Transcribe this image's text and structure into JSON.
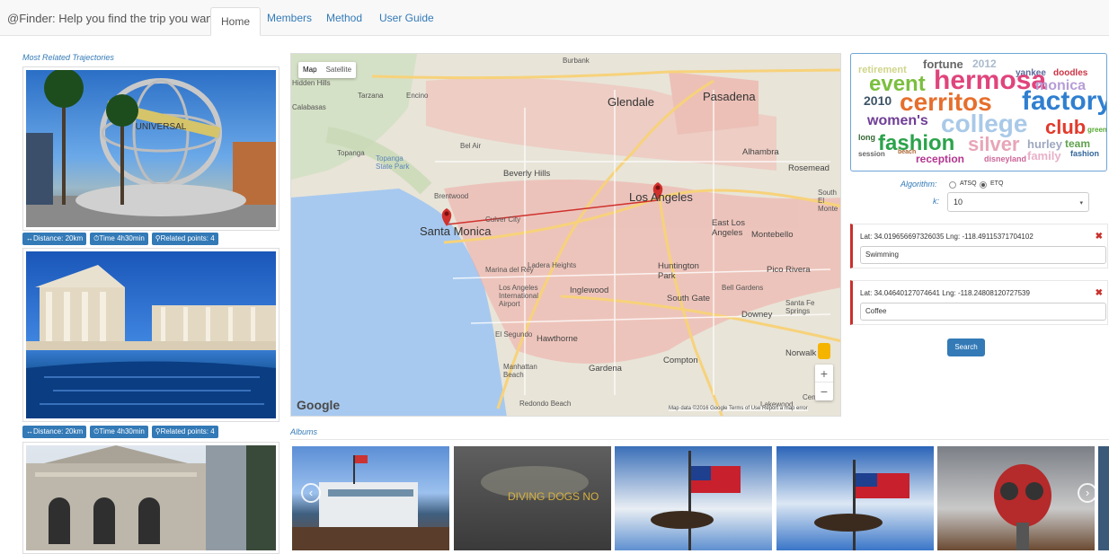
{
  "nav": {
    "brand": "@Finder: Help you find the trip you want!",
    "tabs": [
      "Home",
      "Members",
      "Method",
      "User Guide"
    ]
  },
  "left": {
    "title": "Most Related Trajectories",
    "badges": [
      {
        "distance": "↔Distance: 20km",
        "time": "⏱Time 4h30min",
        "related": "⚲Related points: 4"
      },
      {
        "distance": "↔Distance: 20km",
        "time": "⏱Time 4h30min",
        "related": "⚲Related points: 4"
      }
    ],
    "sign_text": "UNIVERSAL"
  },
  "map": {
    "toggle": [
      "Map",
      "Satellite"
    ],
    "big_labels": [
      "Glendale",
      "Pasadena",
      "Los Angeles",
      "Santa Monica"
    ],
    "labels": [
      "Burbank",
      "Alhambra",
      "Rosemead",
      "Beverly Hills",
      "East Los Angeles",
      "Montebello",
      "Huntington Park",
      "Pico Rivera",
      "Inglewood",
      "Los Angeles International Airport",
      "South Gate",
      "Downey",
      "Hawthorne",
      "El Segundo",
      "Compton",
      "Norwalk",
      "Manhattan Beach",
      "Gardena",
      "Redondo Beach",
      "Topanga",
      "Topanga State Park",
      "Ladera Heights",
      "Bell Gardens",
      "Santa Fe Springs",
      "Cerritos",
      "Lakewood",
      "Marina del Rey",
      "Culver City",
      "Calabasas",
      "Hidden Hills",
      "Tarzana",
      "Encino",
      "South El Monte",
      "Bel Air",
      "Brentwood"
    ],
    "zoom_in": "+",
    "zoom_out": "−",
    "google": "Google",
    "attribution": "Map data ©2016 Google   Terms of Use   Report a map error"
  },
  "wordcloud": {
    "words": [
      {
        "t": "hermosa",
        "c": "#e0447c"
      },
      {
        "t": "cerritos",
        "c": "#e66f2c"
      },
      {
        "t": "factory",
        "c": "#2f7fd0"
      },
      {
        "t": "college",
        "c": "#a9c9e8"
      },
      {
        "t": "fashion",
        "c": "#2ba34b"
      },
      {
        "t": "silver",
        "c": "#e8a5b8"
      },
      {
        "t": "event",
        "c": "#7bbf3f"
      },
      {
        "t": "club",
        "c": "#e23a2c"
      },
      {
        "t": "women's",
        "c": "#6f3d96"
      },
      {
        "t": "monica",
        "c": "#b59dd6"
      },
      {
        "t": "fortune",
        "c": "#666666"
      },
      {
        "t": "2010",
        "c": "#3d5466"
      },
      {
        "t": "reception",
        "c": "#b2358f"
      },
      {
        "t": "hurley",
        "c": "#9fa8c0"
      },
      {
        "t": "team",
        "c": "#5fa14d"
      },
      {
        "t": "family",
        "c": "#e9b0c8"
      },
      {
        "t": "disneyland",
        "c": "#cc6699"
      },
      {
        "t": "retirement",
        "c": "#cfd58a"
      },
      {
        "t": "yankee",
        "c": "#5e6a9b"
      },
      {
        "t": "doodles",
        "c": "#cc3344"
      },
      {
        "t": "2012",
        "c": "#aabbcc"
      },
      {
        "t": "session",
        "c": "#666666"
      },
      {
        "t": "fashion",
        "c": "#336699"
      },
      {
        "t": "long",
        "c": "#336633"
      },
      {
        "t": "green",
        "c": "#55aa33"
      },
      {
        "t": "beach",
        "c": "#aa6633"
      }
    ]
  },
  "controls": {
    "algorithm_label": "Algorithm:",
    "options": [
      "ATSQ",
      "ETQ"
    ],
    "k_label": "k:",
    "k_value": "10",
    "k_caret": "▾",
    "points": [
      {
        "coord": "Lat: 34.019656697326035 Lng: -118.49115371704102",
        "value": "Swimming"
      },
      {
        "coord": "Lat: 34.04640127074641 Lng: -118.24808120727539",
        "value": "Coffee"
      }
    ],
    "remove_icon": "✖",
    "search": "Search"
  },
  "albums": {
    "title": "Albums",
    "prev": "‹",
    "next": "›",
    "sign": "DIVING DOGS NO"
  },
  "colors": {
    "accent": "#337ab7",
    "danger": "#c9302c",
    "route": "#d0312d"
  }
}
